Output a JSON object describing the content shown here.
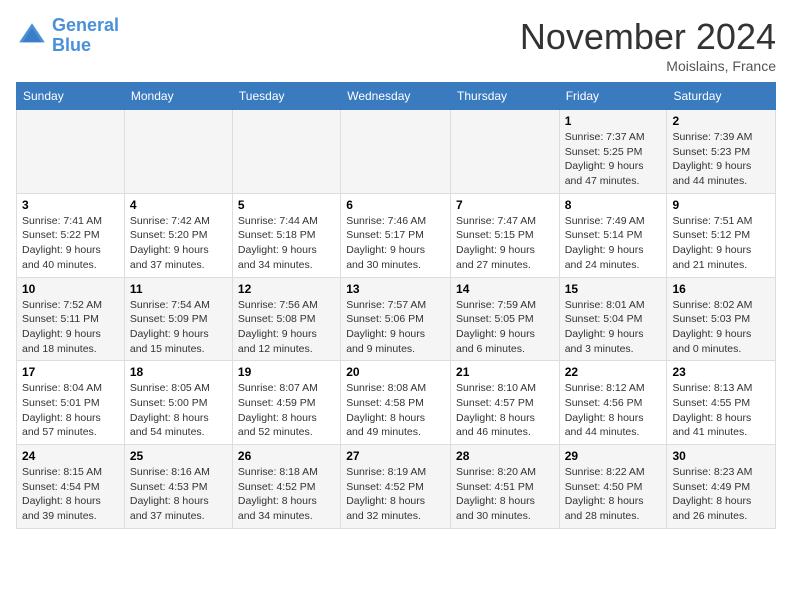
{
  "header": {
    "logo_line1": "General",
    "logo_line2": "Blue",
    "month": "November 2024",
    "location": "Moislains, France"
  },
  "weekdays": [
    "Sunday",
    "Monday",
    "Tuesday",
    "Wednesday",
    "Thursday",
    "Friday",
    "Saturday"
  ],
  "weeks": [
    [
      {
        "day": "",
        "info": ""
      },
      {
        "day": "",
        "info": ""
      },
      {
        "day": "",
        "info": ""
      },
      {
        "day": "",
        "info": ""
      },
      {
        "day": "",
        "info": ""
      },
      {
        "day": "1",
        "info": "Sunrise: 7:37 AM\nSunset: 5:25 PM\nDaylight: 9 hours and 47 minutes."
      },
      {
        "day": "2",
        "info": "Sunrise: 7:39 AM\nSunset: 5:23 PM\nDaylight: 9 hours and 44 minutes."
      }
    ],
    [
      {
        "day": "3",
        "info": "Sunrise: 7:41 AM\nSunset: 5:22 PM\nDaylight: 9 hours and 40 minutes."
      },
      {
        "day": "4",
        "info": "Sunrise: 7:42 AM\nSunset: 5:20 PM\nDaylight: 9 hours and 37 minutes."
      },
      {
        "day": "5",
        "info": "Sunrise: 7:44 AM\nSunset: 5:18 PM\nDaylight: 9 hours and 34 minutes."
      },
      {
        "day": "6",
        "info": "Sunrise: 7:46 AM\nSunset: 5:17 PM\nDaylight: 9 hours and 30 minutes."
      },
      {
        "day": "7",
        "info": "Sunrise: 7:47 AM\nSunset: 5:15 PM\nDaylight: 9 hours and 27 minutes."
      },
      {
        "day": "8",
        "info": "Sunrise: 7:49 AM\nSunset: 5:14 PM\nDaylight: 9 hours and 24 minutes."
      },
      {
        "day": "9",
        "info": "Sunrise: 7:51 AM\nSunset: 5:12 PM\nDaylight: 9 hours and 21 minutes."
      }
    ],
    [
      {
        "day": "10",
        "info": "Sunrise: 7:52 AM\nSunset: 5:11 PM\nDaylight: 9 hours and 18 minutes."
      },
      {
        "day": "11",
        "info": "Sunrise: 7:54 AM\nSunset: 5:09 PM\nDaylight: 9 hours and 15 minutes."
      },
      {
        "day": "12",
        "info": "Sunrise: 7:56 AM\nSunset: 5:08 PM\nDaylight: 9 hours and 12 minutes."
      },
      {
        "day": "13",
        "info": "Sunrise: 7:57 AM\nSunset: 5:06 PM\nDaylight: 9 hours and 9 minutes."
      },
      {
        "day": "14",
        "info": "Sunrise: 7:59 AM\nSunset: 5:05 PM\nDaylight: 9 hours and 6 minutes."
      },
      {
        "day": "15",
        "info": "Sunrise: 8:01 AM\nSunset: 5:04 PM\nDaylight: 9 hours and 3 minutes."
      },
      {
        "day": "16",
        "info": "Sunrise: 8:02 AM\nSunset: 5:03 PM\nDaylight: 9 hours and 0 minutes."
      }
    ],
    [
      {
        "day": "17",
        "info": "Sunrise: 8:04 AM\nSunset: 5:01 PM\nDaylight: 8 hours and 57 minutes."
      },
      {
        "day": "18",
        "info": "Sunrise: 8:05 AM\nSunset: 5:00 PM\nDaylight: 8 hours and 54 minutes."
      },
      {
        "day": "19",
        "info": "Sunrise: 8:07 AM\nSunset: 4:59 PM\nDaylight: 8 hours and 52 minutes."
      },
      {
        "day": "20",
        "info": "Sunrise: 8:08 AM\nSunset: 4:58 PM\nDaylight: 8 hours and 49 minutes."
      },
      {
        "day": "21",
        "info": "Sunrise: 8:10 AM\nSunset: 4:57 PM\nDaylight: 8 hours and 46 minutes."
      },
      {
        "day": "22",
        "info": "Sunrise: 8:12 AM\nSunset: 4:56 PM\nDaylight: 8 hours and 44 minutes."
      },
      {
        "day": "23",
        "info": "Sunrise: 8:13 AM\nSunset: 4:55 PM\nDaylight: 8 hours and 41 minutes."
      }
    ],
    [
      {
        "day": "24",
        "info": "Sunrise: 8:15 AM\nSunset: 4:54 PM\nDaylight: 8 hours and 39 minutes."
      },
      {
        "day": "25",
        "info": "Sunrise: 8:16 AM\nSunset: 4:53 PM\nDaylight: 8 hours and 37 minutes."
      },
      {
        "day": "26",
        "info": "Sunrise: 8:18 AM\nSunset: 4:52 PM\nDaylight: 8 hours and 34 minutes."
      },
      {
        "day": "27",
        "info": "Sunrise: 8:19 AM\nSunset: 4:52 PM\nDaylight: 8 hours and 32 minutes."
      },
      {
        "day": "28",
        "info": "Sunrise: 8:20 AM\nSunset: 4:51 PM\nDaylight: 8 hours and 30 minutes."
      },
      {
        "day": "29",
        "info": "Sunrise: 8:22 AM\nSunset: 4:50 PM\nDaylight: 8 hours and 28 minutes."
      },
      {
        "day": "30",
        "info": "Sunrise: 8:23 AM\nSunset: 4:49 PM\nDaylight: 8 hours and 26 minutes."
      }
    ]
  ]
}
